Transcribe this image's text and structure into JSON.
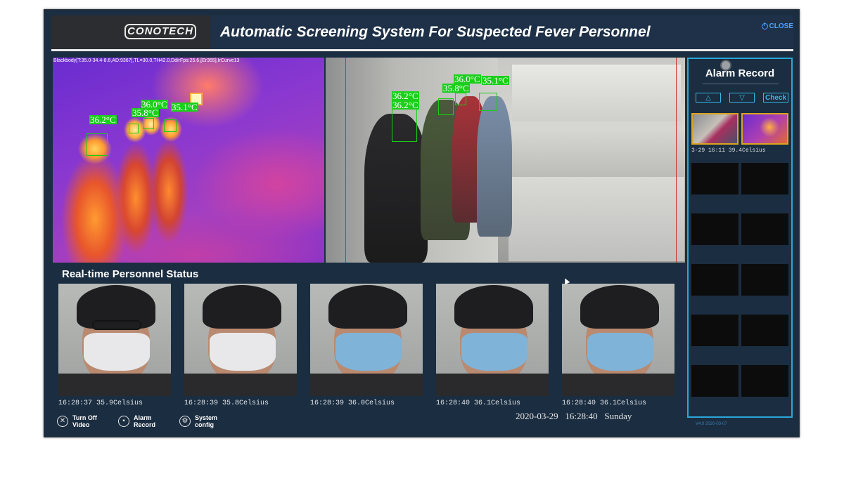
{
  "header": {
    "logo_text": "CONOTECH",
    "title": "Automatic Screening System For Suspected Fever Personnel",
    "close_label": "CLOSE"
  },
  "thermal_view": {
    "info_text": "Blackbody[T:35.0-34.4-8.6,AD:9367],TL=30.0,TH42.0,DdirFps:25.6,[Er355],IrCurve13",
    "labels": [
      "36.2°C",
      "36.0°C",
      "35.8°C",
      "35.1°C"
    ]
  },
  "camera_view": {
    "labels": [
      "36.2°C",
      "36.2°C",
      "36.0°C",
      "35.8°C",
      "35.1°C"
    ]
  },
  "alarm_record": {
    "title": "Alarm Record",
    "up_icon": "△",
    "down_icon": "▽",
    "check_label": "Check",
    "record_caption": "3-29 16:11 39.4Celsius",
    "version_text": "V4.0 2020-03-07"
  },
  "realtime": {
    "title": "Real-time Personnel Status",
    "captures": [
      {
        "caption": "16:28:37 35.9Celsius"
      },
      {
        "caption": "16:28:39 35.8Celsius"
      },
      {
        "caption": "16:28:39 36.0Celsius"
      },
      {
        "caption": "16:28:40 36.1Celsius"
      },
      {
        "caption": "16:28:40 36.1Celsius"
      }
    ]
  },
  "controls": {
    "turn_off_video": "Turn Off Video",
    "alarm_record": "Alarm Record",
    "system_config": "System config"
  },
  "status": {
    "date": "2020-03-29",
    "time": "16:28:40",
    "weekday": "Sunday"
  },
  "colors": {
    "background": "#1b2d40",
    "accent": "#2aa7d8",
    "detection_green": "#1ccf1c",
    "alarm_border": "#d8a520"
  }
}
